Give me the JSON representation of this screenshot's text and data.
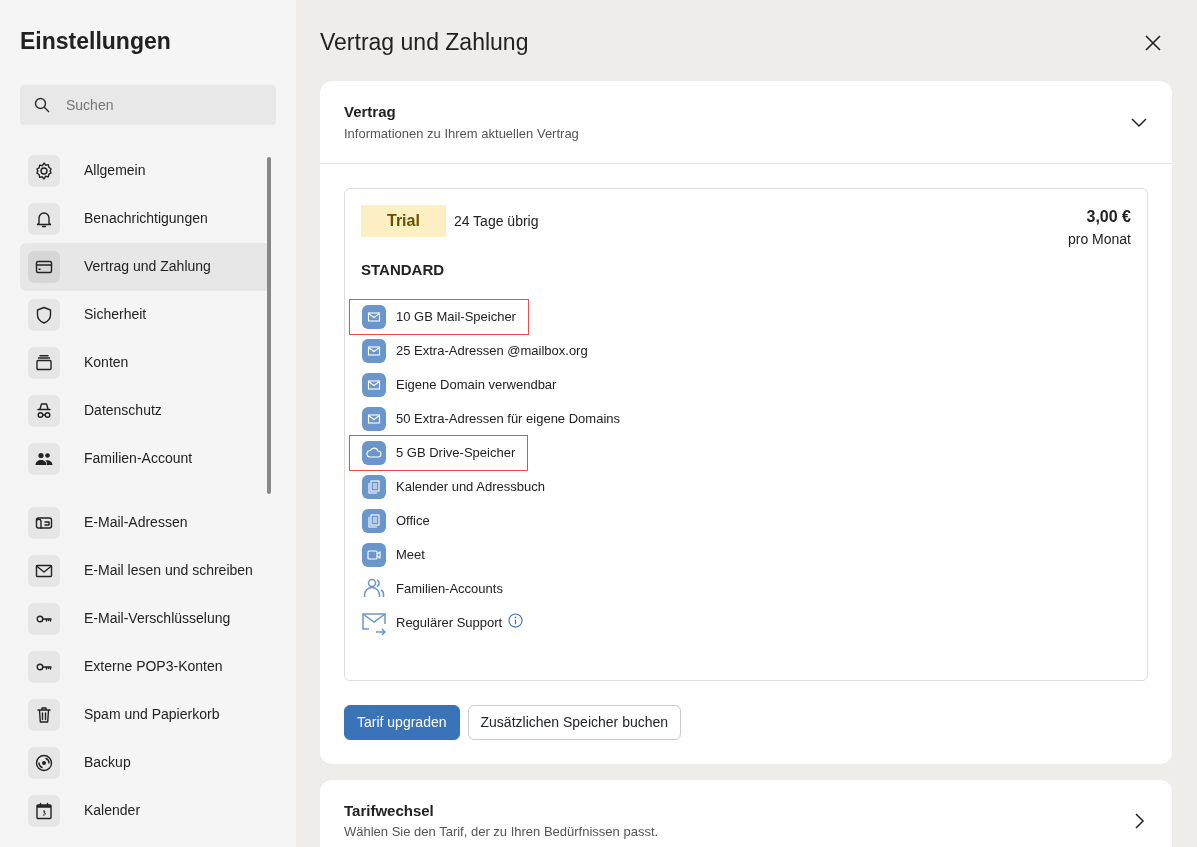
{
  "sidebar": {
    "title": "Einstellungen",
    "search": {
      "placeholder": "Suchen"
    },
    "groups": [
      {
        "items": [
          {
            "label": "Allgemein",
            "selected": false
          },
          {
            "label": "Benachrichtigungen",
            "selected": false
          },
          {
            "label": "Vertrag und Zahlung",
            "selected": true
          },
          {
            "label": "Sicherheit",
            "selected": false
          },
          {
            "label": "Konten",
            "selected": false
          },
          {
            "label": "Datenschutz",
            "selected": false
          },
          {
            "label": "Familien-Account",
            "selected": false
          }
        ]
      },
      {
        "items": [
          {
            "label": "E-Mail-Adressen",
            "selected": false
          },
          {
            "label": "E-Mail lesen und schreiben",
            "selected": false
          },
          {
            "label": "E-Mail-Verschlüsselung",
            "selected": false
          },
          {
            "label": "Externe POP3-Konten",
            "selected": false
          },
          {
            "label": "Spam und Papierkorb",
            "selected": false
          },
          {
            "label": "Backup",
            "selected": false
          },
          {
            "label": "Kalender",
            "selected": false
          }
        ]
      }
    ]
  },
  "main": {
    "title": "Vertrag und Zahlung",
    "contract": {
      "title": "Vertrag",
      "subtitle": "Informationen zu Ihrem aktuellen Vertrag",
      "expanded": true,
      "badge": "Trial",
      "remaining": "24 Tage übrig",
      "price": "3,00 €",
      "period": "pro Monat",
      "plan": "STANDARD",
      "features": [
        {
          "kind": "mail",
          "label": "10 GB Mail-Speicher",
          "highlighted": true
        },
        {
          "kind": "mail",
          "label": "25 Extra-Adressen @mailbox.org",
          "highlighted": false
        },
        {
          "kind": "mail",
          "label": "Eigene Domain verwendbar",
          "highlighted": false
        },
        {
          "kind": "mail",
          "label": "50 Extra-Adressen für eigene Domains",
          "highlighted": false
        },
        {
          "kind": "cloud",
          "label": "5 GB Drive-Speicher",
          "highlighted": true
        },
        {
          "kind": "docs",
          "label": "Kalender und Adressbuch",
          "highlighted": false
        },
        {
          "kind": "docs",
          "label": "Office",
          "highlighted": false
        },
        {
          "kind": "video",
          "label": "Meet",
          "highlighted": false
        },
        {
          "kind": "people",
          "label": "Familien-Accounts",
          "highlighted": false
        },
        {
          "kind": "support",
          "label": "Regulärer Support",
          "highlighted": false,
          "info": true
        }
      ],
      "buttons": [
        {
          "label": "Tarif upgraden",
          "primary": true
        },
        {
          "label": "Zusätzlichen Speicher buchen",
          "primary": false
        }
      ]
    },
    "change": {
      "title": "Tarifwechsel",
      "subtitle": "Wählen Sie den Tarif, der zu Ihren Bedürfnissen passt."
    }
  }
}
